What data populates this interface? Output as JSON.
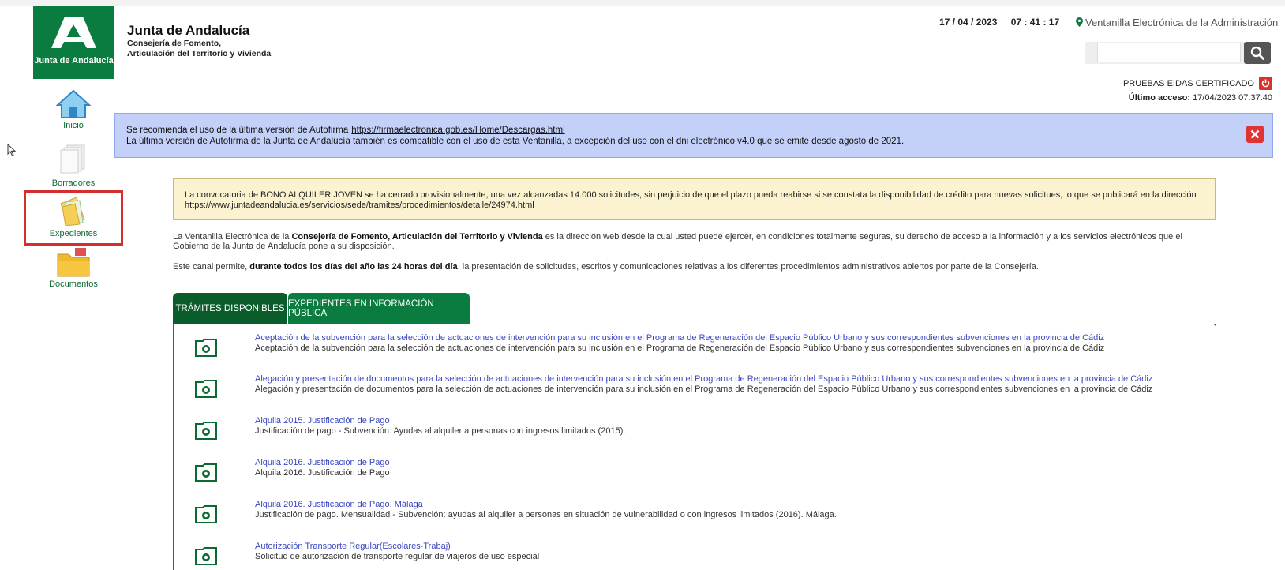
{
  "header": {
    "logo_text": "Junta de Andalucía",
    "org_title": "Junta de Andalucía",
    "org_sub1": "Consejería de Fomento,",
    "org_sub2": "Articulación del Territorio y Vivienda",
    "date": "17 / 04 / 2023",
    "time": "07 : 41 : 17",
    "portal": "Ventanilla Electrónica de la Administración",
    "search_value": "",
    "cert_user": "PRUEBAS EIDAS CERTIFICADO",
    "last_access_label": "Último acceso:",
    "last_access_value": "17/04/2023 07:37:40"
  },
  "nav": {
    "inicio": "Inicio",
    "borradores": "Borradores",
    "expedientes": "Expedientes",
    "documentos": "Documentos"
  },
  "banner": {
    "line1": "Se recomienda el uso de la última versión de Autofirma",
    "link": "https://firmaelectronica.gob.es/Home/Descargas.html",
    "line2": "La última versión de Autofirma de la Junta de Andalucía también es compatible con el uso de esta Ventanilla, a excepción del uso con el dni electrónico v4.0 que se emite desde agosto de 2021."
  },
  "warning": {
    "line1": "La convocatoria de BONO ALQUILER JOVEN se ha cerrado provisionalmente, una vez alcanzadas 14.000 solicitudes, sin perjuicio de que el plazo pueda reabirse si se constata la disponibilidad de crédito para nuevas solicitues, lo que se publicará en la dirección",
    "line2": "https://www.juntadeandalucia.es/servicios/sede/tramites/procedimientos/detalle/24974.html"
  },
  "intro": {
    "p1_a": "La Ventanilla Electrónica de la ",
    "p1_b": "Consejería de Fomento, Articulación del Territorio y Vivienda",
    "p1_c": " es la dirección web desde la cual usted puede ejercer, en condiciones totalmente seguras, su derecho de acceso a la información y a los servicios electrónicos que el Gobierno de la Junta de Andalucía pone a su disposición.",
    "p2_a": "Este canal permite, ",
    "p2_b": "durante todos los días del año las 24 horas del día",
    "p2_c": ", la presentación de solicitudes, escritos y comunicaciones relativas a los diferentes procedimientos administrativos abiertos por parte de la Consejería."
  },
  "tabs": [
    {
      "label": "TRÁMITES DISPONIBLES"
    },
    {
      "label": "EXPEDIENTES EN INFORMACIÓN PÚBLICA"
    }
  ],
  "procedures": [
    {
      "title": "Aceptación de la subvención para la selección de actuaciones de intervención para su inclusión en el Programa de Regeneración del Espacio Público Urbano y sus correspondientes subvenciones en la provincia de Cádiz",
      "desc": "Aceptación de la subvención para la selección de actuaciones de intervención para su inclusión en el Programa de Regeneración del Espacio Público Urbano y sus correspondientes subvenciones en la provincia de Cádiz"
    },
    {
      "title": "Alegación y presentación de documentos para la selección de actuaciones de intervención para su inclusión en el Programa de Regeneración del Espacio Público Urbano y sus correspondientes subvenciones en la provincia de Cádiz",
      "desc": "Alegación y presentación de documentos para la selección de actuaciones de intervención para su inclusión en el Programa de Regeneración del Espacio Público Urbano y sus correspondientes subvenciones en la provincia de Cádiz"
    },
    {
      "title": "Alquila 2015. Justificación de Pago",
      "desc": "Justificación de pago - Subvención: Ayudas al alquiler a personas con ingresos limitados (2015)."
    },
    {
      "title": "Alquila 2016. Justificación de Pago",
      "desc": "Alquila 2016. Justificación de Pago"
    },
    {
      "title": "Alquila 2016. Justificación de Pago. Málaga",
      "desc": "Justificación de pago. Mensualidad - Subvención: ayudas al alquiler a personas en situación de vulnerabilidad o con ingresos limitados (2016). Málaga."
    },
    {
      "title": "Autorización Transporte Regular(Escolares-Trabaj)",
      "desc": "Solicitud de autorización de transporte regular de viajeros de uso especial"
    }
  ],
  "colors": {
    "brand_green": "#0b7c3f",
    "tab_active": "#0b5c2b",
    "banner_blue": "#c3d1f9",
    "warning_bg": "#fbf3d0",
    "link_blue": "#3a47c2",
    "close_red": "#e03434"
  }
}
